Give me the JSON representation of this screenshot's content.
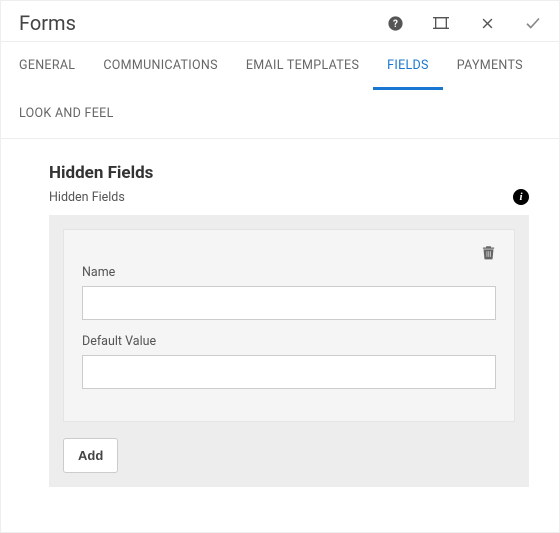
{
  "header": {
    "title": "Forms"
  },
  "tabs": [
    {
      "label": "GENERAL",
      "active": false
    },
    {
      "label": "COMMUNICATIONS",
      "active": false
    },
    {
      "label": "EMAIL TEMPLATES",
      "active": false
    },
    {
      "label": "FIELDS",
      "active": true
    },
    {
      "label": "PAYMENTS",
      "active": false
    },
    {
      "label": "LOOK AND FEEL",
      "active": false
    }
  ],
  "section": {
    "title": "Hidden Fields",
    "subtitle": "Hidden Fields"
  },
  "field": {
    "name_label": "Name",
    "name_value": "",
    "default_label": "Default Value",
    "default_value": ""
  },
  "buttons": {
    "add": "Add"
  }
}
